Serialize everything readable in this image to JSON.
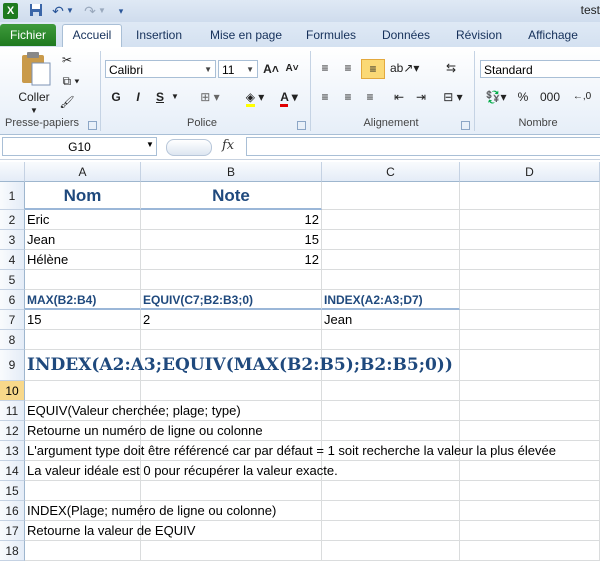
{
  "window": {
    "title": "test"
  },
  "quick_access": {
    "excel_icon": "X",
    "save_icon": "save-icon",
    "undo_icon": "undo-icon",
    "redo_icon": "redo-icon"
  },
  "tabs": [
    {
      "label": "Fichier"
    },
    {
      "label": "Accueil"
    },
    {
      "label": "Insertion"
    },
    {
      "label": "Mise en page"
    },
    {
      "label": "Formules"
    },
    {
      "label": "Données"
    },
    {
      "label": "Révision"
    },
    {
      "label": "Affichage"
    }
  ],
  "ribbon": {
    "clipboard": {
      "paste_label": "Coller",
      "group_label": "Presse-papiers"
    },
    "font": {
      "name": "Calibri",
      "size": "11",
      "bold": "G",
      "italic": "I",
      "underline": "S",
      "group_label": "Police"
    },
    "alignment": {
      "group_label": "Alignement"
    },
    "number": {
      "format": "Standard",
      "percent": "%",
      "thousands": "000",
      "group_label": "Nombre"
    }
  },
  "formula_bar": {
    "cell_ref": "G10",
    "fx": "fx",
    "content": ""
  },
  "columns": [
    "A",
    "B",
    "C",
    "D"
  ],
  "rows": [
    "1",
    "2",
    "3",
    "4",
    "5",
    "6",
    "7",
    "8",
    "9",
    "10",
    "11",
    "12",
    "13",
    "14",
    "15",
    "16",
    "17",
    "18"
  ],
  "selected_row": "10",
  "cells": {
    "A1": "Nom",
    "B1": "Note",
    "A2": "Eric",
    "B2": "12",
    "A3": "Jean",
    "B3": "15",
    "A4": "Hélène",
    "B4": "12",
    "A6": "MAX(B2:B4)",
    "B6": "EQUIV(C7;B2:B3;0)",
    "C6": "INDEX(A2:A3;D7)",
    "A7": "15",
    "B7": "2",
    "C7": "Jean",
    "A9": "INDEX(A2:A3;EQUIV(MAX(B2:B5);B2:B5;0))",
    "A11": "EQUIV(Valeur cherchée; plage; type)",
    "A12": "Retourne un numéro de ligne ou colonne",
    "A13": "L'argument type doit être référencé car par défaut = 1 soit recherche la valeur la plus élevée",
    "A14": "La valeur idéale est 0 pour récupérer la valeur exacte.",
    "A16": "INDEX(Plage; numéro de ligne  ou colonne)",
    "A17": "Retourne la valeur de EQUIV"
  }
}
